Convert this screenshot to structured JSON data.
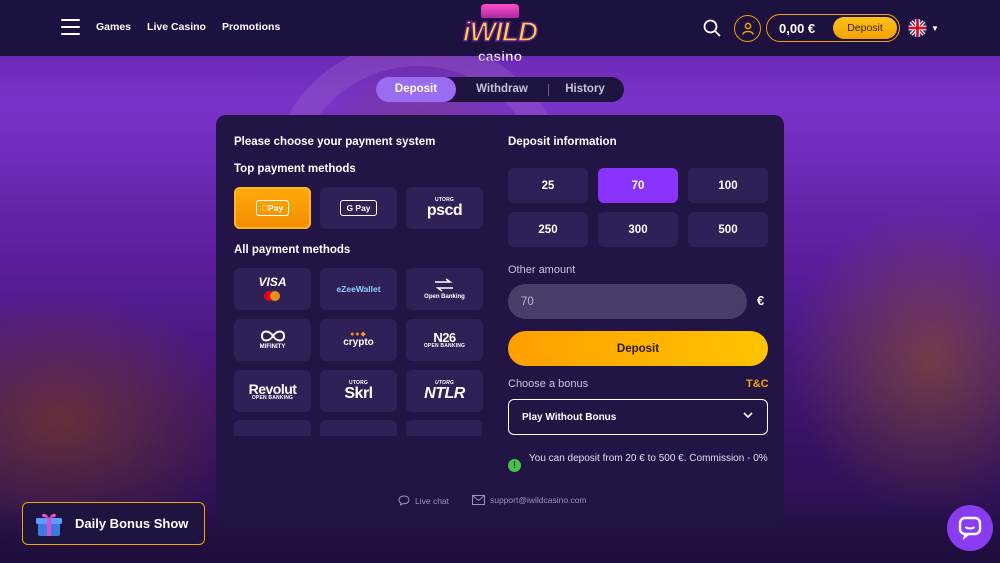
{
  "header": {
    "nav": [
      "Games",
      "Live Casino",
      "Promotions"
    ],
    "logo_word": "iWILD",
    "logo_sub": "casino",
    "balance": "0,00 €",
    "deposit_label": "Deposit"
  },
  "tabs": [
    "Deposit",
    "Withdraw",
    "History"
  ],
  "left": {
    "title": "Please choose your payment system",
    "top_title": "Top payment methods",
    "all_title": "All payment methods",
    "top_methods": [
      {
        "label": "Pay",
        "icon": "apple-pay-icon"
      },
      {
        "label": "G Pay",
        "icon": "google-pay-icon"
      },
      {
        "label": "pscd",
        "small": "UTORG"
      }
    ],
    "all_methods": [
      {
        "label": "VISA",
        "icon": "visa-mastercard-icon"
      },
      {
        "label": "eZeeWallet"
      },
      {
        "label": "Open Banking"
      },
      {
        "label": "MIFINITY"
      },
      {
        "label": "crypto"
      },
      {
        "label": "N26",
        "small": "OPEN BANKING"
      },
      {
        "label": "Revolut",
        "small": "OPEN BANKING"
      },
      {
        "label": "Skrl",
        "small": "UTORG"
      },
      {
        "label": "NTLR",
        "small": "UTORG"
      }
    ]
  },
  "right": {
    "title": "Deposit information",
    "amounts": [
      "25",
      "70",
      "100",
      "250",
      "300",
      "500"
    ],
    "selected_amount": "70",
    "other_label": "Other amount",
    "other_value": "70",
    "currency": "€",
    "deposit_button": "Deposit",
    "bonus_label": "Choose a bonus",
    "tc": "T&C",
    "bonus_value": "Play Without Bonus",
    "info": "You can deposit from 20 € to 500 €. Commission - 0%"
  },
  "footer": {
    "live_chat": "Live chat",
    "email": "support@iwildcasino.com"
  },
  "daily_bonus": "Daily Bonus Show",
  "colors": {
    "accent": "#f5a300",
    "purple": "#8a33ff",
    "panel": "#231446"
  }
}
